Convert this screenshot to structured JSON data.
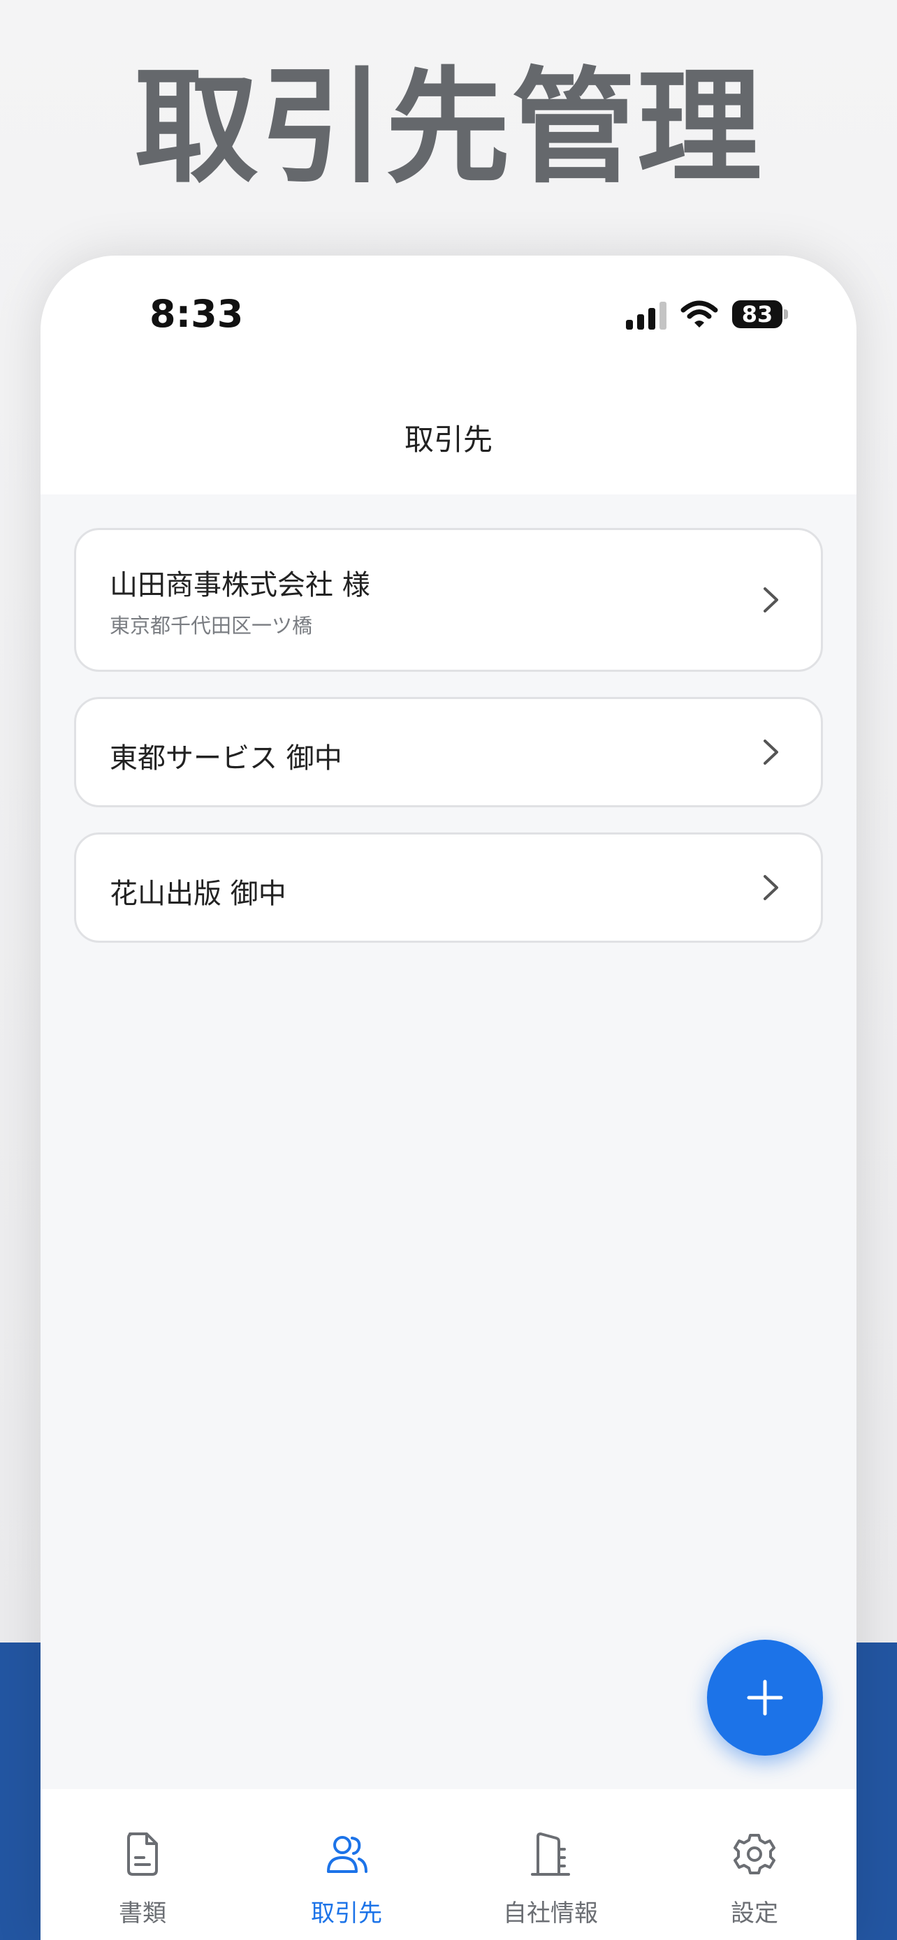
{
  "hero": {
    "title": "取引先管理"
  },
  "status_bar": {
    "time": "8:33",
    "battery": "83"
  },
  "nav": {
    "title": "取引先"
  },
  "clients": [
    {
      "name": "山田商事株式会社 様",
      "address": "東京都千代田区一ツ橋"
    },
    {
      "name": "東都サービス 御中"
    },
    {
      "name": "花山出版 御中"
    }
  ],
  "fab": {
    "icon": "plus-icon"
  },
  "tabs": [
    {
      "label": "書類",
      "icon": "document-icon",
      "active": false
    },
    {
      "label": "取引先",
      "icon": "people-icon",
      "active": true
    },
    {
      "label": "自社情報",
      "icon": "building-icon",
      "active": false
    },
    {
      "label": "設定",
      "icon": "gear-icon",
      "active": false
    }
  ],
  "colors": {
    "accent": "#1c73e8",
    "hero_text": "#65686c",
    "band": "#2356a2",
    "tab_inactive": "#6b6e73"
  }
}
